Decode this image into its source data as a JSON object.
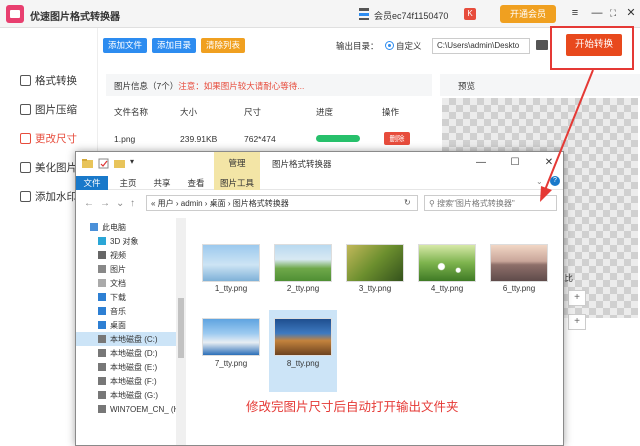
{
  "app": {
    "title": "优速图片格式转换器",
    "member_id": "会员ec74f1150470",
    "k_badge": "K",
    "vip_label": "开通会员",
    "ctrl_menu": "≡",
    "ctrl_min": "—",
    "ctrl_max": "⛶",
    "ctrl_close": "✕"
  },
  "sidebar": {
    "items": [
      {
        "label": "格式转换"
      },
      {
        "label": "图片压缩"
      },
      {
        "label": "更改尺寸"
      },
      {
        "label": "美化图片"
      },
      {
        "label": "添加水印"
      }
    ]
  },
  "toolbar": {
    "add_file": "添加文件",
    "add_dir": "添加目录",
    "clear_list": "清除列表",
    "out_label": "输出目录：",
    "radio_label": "自定义",
    "path_value": "C:\\Users\\admin\\Deskto",
    "start": "开始转换"
  },
  "info": {
    "title": "图片信息（7个）",
    "warn": "注意：如果图片较大请耐心等待...",
    "headers": [
      "文件名称",
      "大小",
      "尺寸",
      "进度",
      "操作"
    ],
    "row": {
      "name": "1.png",
      "size": "239.91KB",
      "dim": "762*474",
      "progress": 1.0,
      "action": "删除"
    }
  },
  "preview": {
    "title": "预览",
    "cut_label": "宽比"
  },
  "explorer": {
    "title": "图片格式转换器",
    "manage": "管理",
    "ribbon": [
      "文件",
      "主页",
      "共享",
      "查看",
      "图片工具"
    ],
    "address": "«  用户  ›  admin  ›  桌面  ›  图片格式转换器",
    "search_placeholder": "搜索\"图片格式转换器\"",
    "nav": [
      {
        "label": "此电脑"
      },
      {
        "label": "3D 对象"
      },
      {
        "label": "视频"
      },
      {
        "label": "图片"
      },
      {
        "label": "文档"
      },
      {
        "label": "下载"
      },
      {
        "label": "音乐"
      },
      {
        "label": "桌面"
      },
      {
        "label": "本地磁盘 (C:)"
      },
      {
        "label": "本地磁盘 (D:)"
      },
      {
        "label": "本地磁盘 (E:)"
      },
      {
        "label": "本地磁盘 (F:)"
      },
      {
        "label": "本地磁盘 (G:)"
      },
      {
        "label": "WIN7OEM_CN_ (H"
      }
    ],
    "files": [
      {
        "name": "1_tty.png"
      },
      {
        "name": "2_tty.png"
      },
      {
        "name": "3_tty.png"
      },
      {
        "name": "4_tty.png"
      },
      {
        "name": "6_tty.png"
      },
      {
        "name": "7_tty.png"
      },
      {
        "name": "8_tty.png"
      }
    ],
    "caption": "修改完图片尺寸后自动打开输出文件夹"
  },
  "colors": {
    "accent_red": "#e8491d",
    "progress_green": "#27c06b",
    "button_blue": "#2d8cf0",
    "button_orange": "#f0a020"
  }
}
